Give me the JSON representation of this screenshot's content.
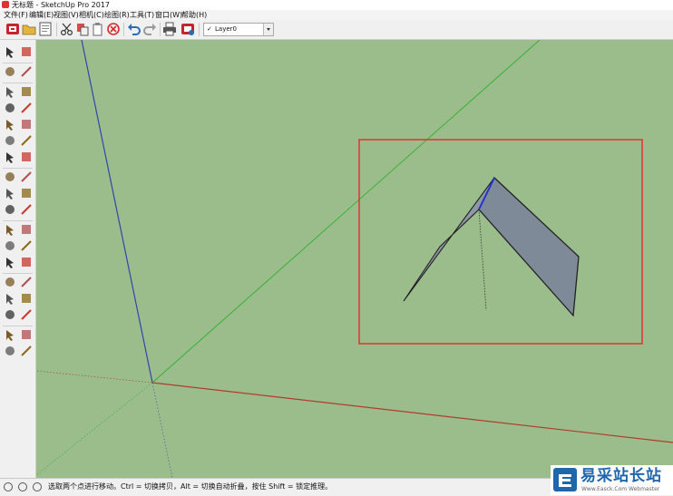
{
  "window": {
    "title": "无标题 - SketchUp Pro 2017"
  },
  "menu": [
    "文件(F)",
    "编辑(E)",
    "视图(V)",
    "相机(C)",
    "绘图(R)",
    "工具(T)",
    "窗口(W)",
    "帮助(H)"
  ],
  "layer": {
    "checkmark": "✓",
    "name": "Layer0"
  },
  "toolbar_icons": [
    "sketchup-logo-icon",
    "open-folder-icon",
    "save-icon",
    "cut-icon",
    "copy-icon",
    "paste-icon",
    "erase-delete-icon",
    "undo-icon",
    "redo-icon",
    "print-icon",
    "model-info-icon"
  ],
  "tool_icons": [
    "select-arrow-icon",
    "make-component-icon",
    "paint-bucket-icon",
    "eraser-icon",
    "line-pencil-icon",
    "freehand-icon",
    "rectangle-icon",
    "rotated-rectangle-icon",
    "circle-icon",
    "polygon-icon",
    "arc-icon",
    "two-point-arc-icon",
    "three-point-arc-icon",
    "pie-icon",
    "move-icon",
    "push-pull-icon",
    "rotate-icon",
    "follow-me-icon",
    "scale-icon",
    "offset-icon",
    "tape-measure-icon",
    "dimension-icon",
    "protractor-icon",
    "text-icon",
    "axes-icon",
    "3d-text-icon",
    "orbit-icon",
    "pan-icon",
    "zoom-icon",
    "zoom-window-icon",
    "zoom-extents-icon",
    "previous-view-icon",
    "position-camera-icon",
    "look-around-icon",
    "walk-icon",
    "section-plane-icon"
  ],
  "status": {
    "hint": "选取两个点进行移动。Ctrl = 切换拷贝，Alt = 切换自动折叠，按住 Shift = 锁定推理。"
  },
  "watermark": {
    "text": "易采站长站",
    "sub": "Www.Easck.Com Webmaster"
  },
  "colors": {
    "viewport_bg": "#9bbd8c",
    "highlight_box": "#e03a36",
    "blue_axis": "#3344aa",
    "green_axis": "#2fb02f",
    "red_axis": "#b33b2a",
    "roof_face": "#7f8a99"
  }
}
